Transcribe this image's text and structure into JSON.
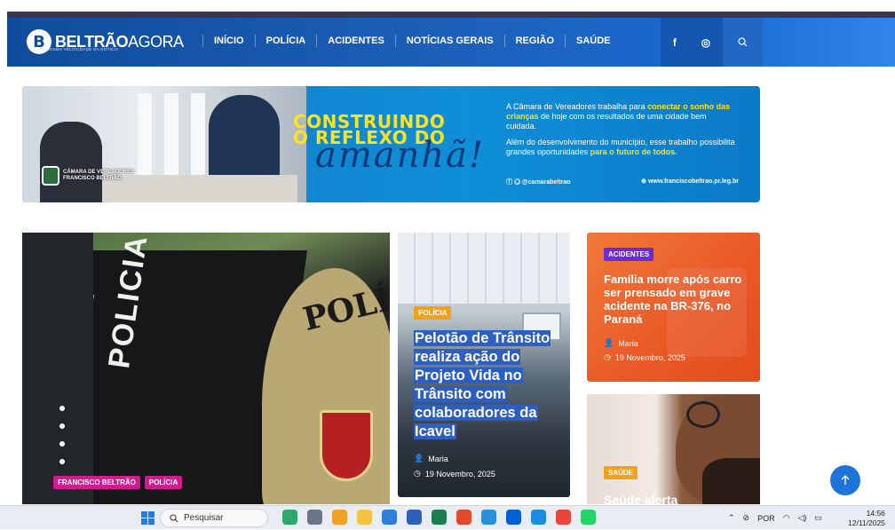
{
  "brand": {
    "name_bold": "BELTRÃO",
    "name_light": "AGORA",
    "tagline": "NA MESMA VELOCIDADE DA NOTÍCIA",
    "logo_letter": "B"
  },
  "nav": {
    "items": [
      {
        "label": "INÍCIO"
      },
      {
        "label": "POLÍCIA"
      },
      {
        "label": "ACIDENTES"
      },
      {
        "label": "NOTÍCIAS GERAIS"
      },
      {
        "label": "REGIÃO"
      },
      {
        "label": "SAÚDE"
      }
    ],
    "social": {
      "facebook": "f",
      "instagram": "◎"
    }
  },
  "banner": {
    "chamber_line1": "CÂMARA DE VEREADORES",
    "chamber_line2": "FRANCISCO BELTRÃO",
    "headline_line1": "CONSTRUINDO",
    "headline_line2": "O REFLEXO DO",
    "script": "amanhã!",
    "text1_pre": "A Câmara de Vereadores  trabalha para ",
    "text1_hl": "conectar o sonho das crianças",
    "text1_post": " de hoje com os resultados de uma cidade bem cuidada.",
    "text2_pre": "Além do desenvolvimento do município, esse trabalho possibilita grandes oportunidades ",
    "text2_hl": "para o futuro de todos.",
    "handle": "@camarabeltrao",
    "website": "www.franciscobeltrao.pr.leg.br"
  },
  "main_card": {
    "tags": [
      "FRANCISCO BELTRÃO",
      "POLÍCIA"
    ],
    "image_text_door": "POLICIA CIVIL",
    "image_text_badge": "POLÍCI"
  },
  "mid_card": {
    "tag": "POLÍCIA",
    "title": "Pelotão de Trânsito realiza ação do Projeto Vida no Trânsito com colaboradores da Icavel",
    "author": "Maria",
    "date": "19 Novembro, 2025"
  },
  "right_card1": {
    "tag": "ACIDENTES",
    "title": "Família morre após carro ser prensado em grave acidente na BR-376, no Paraná",
    "author": "Maria",
    "date": "19 Novembro, 2025"
  },
  "right_card2": {
    "tag": "SAÚDE",
    "title": "Saúde alerta"
  },
  "taskbar": {
    "search_placeholder": "Pesquisar",
    "language": "POR",
    "time": "14:56",
    "date": "12/11/2025"
  },
  "colors": {
    "accent_blue": "#1c5eb6",
    "tag_pink": "#d21b8e",
    "tag_orange": "#f3a11a",
    "tag_purple": "#6a2bd9",
    "highlight_blue": "#2d5fc1"
  }
}
